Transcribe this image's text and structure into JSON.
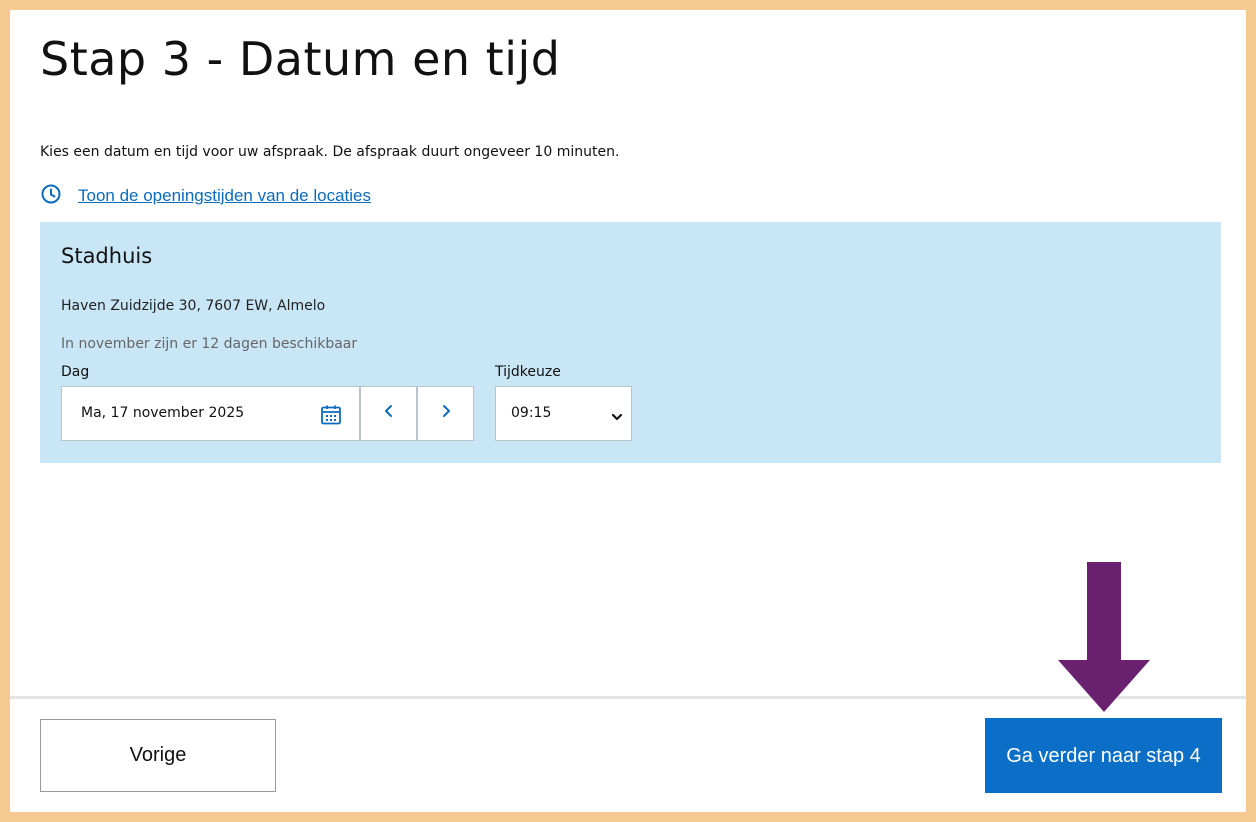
{
  "page": {
    "title": "Stap 3 - Datum en tijd",
    "intro": "Kies een datum en tijd voor uw afspraak. De afspraak duurt ongeveer 10 minuten.",
    "hours_link": "Toon de openingstijden van de locaties"
  },
  "location": {
    "name": "Stadhuis",
    "address": "Haven Zuidzijde 30, 7607 EW, Almelo",
    "availability": "In november zijn er 12 dagen beschikbaar"
  },
  "form": {
    "day_label": "Dag",
    "day_value": "Ma, 17 november 2025",
    "time_label": "Tijdkeuze",
    "time_value": "09:15"
  },
  "footer": {
    "prev_label": "Vorige",
    "next_label": "Ga verder naar stap 4"
  },
  "colors": {
    "frame": "#f6c992",
    "panel": "#c9e6f7",
    "primary": "#0b6fc8",
    "link": "#0b6bbf",
    "annotation_arrow": "#6a2270"
  },
  "icons": {
    "hours": "clock-icon",
    "calendar": "calendar-icon",
    "prev": "chevron-left-icon",
    "next": "chevron-right-icon",
    "select": "chevron-down-icon",
    "annotation": "arrow-down-icon"
  }
}
